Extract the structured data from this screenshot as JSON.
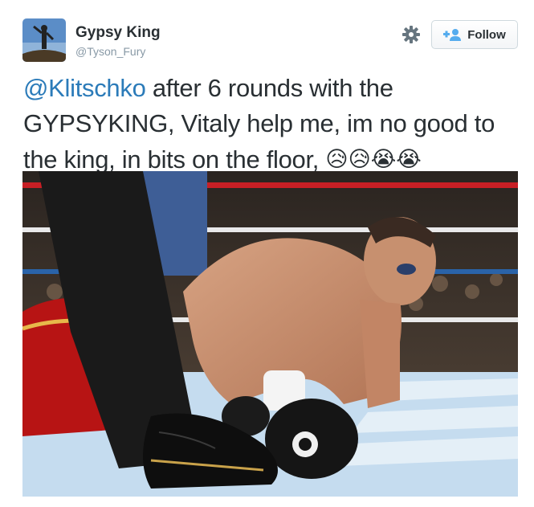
{
  "user": {
    "name": "Gypsy King",
    "handle": "@Tyson_Fury"
  },
  "actions": {
    "follow_label": "Follow",
    "settings_icon": "gear-icon",
    "follow_icon": "add-user-icon"
  },
  "tweet": {
    "mention": "@Klitschko",
    "body": " after 6 rounds with the GYPSYKING, Vitaly help me, im no good to the king, in bits on the floor, ",
    "emojis": "😥😥😭😭"
  },
  "colors": {
    "link": "#2b7bb9",
    "text": "#292f33",
    "muted": "#8899a6"
  }
}
